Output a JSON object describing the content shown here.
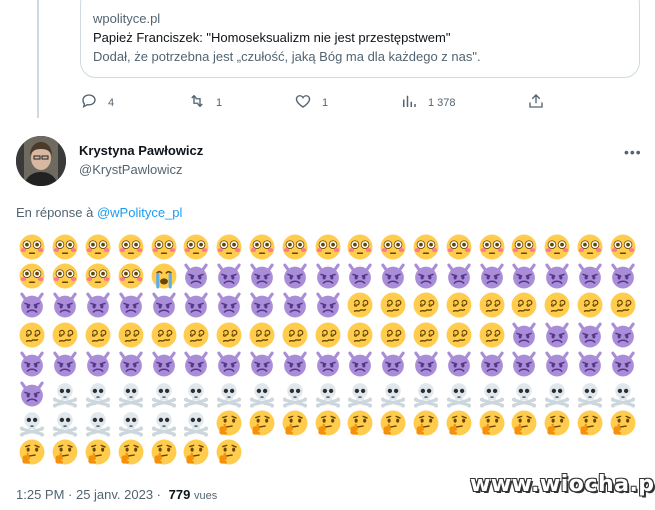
{
  "quoted_tweet": {
    "domain": "wpolityce.pl",
    "title": "Papież Franciszek: \"Homoseksualizm nie jest przestępstwem\"",
    "description": "Dodał, że potrzebna jest „czułość, jaką Bóg ma dla każdego z nas\"."
  },
  "actions": {
    "replies": "4",
    "retweets": "1",
    "likes": "1",
    "views": "1 378"
  },
  "tweet": {
    "author_name": "Krystyna Pawłowicz",
    "author_handle": "@KrystPawlowicz",
    "more_label": "•••",
    "reply_prefix": "En réponse à",
    "reply_mention": "@wPolityce_pl",
    "emoji_rows": [
      [
        "flushed",
        "flushed",
        "flushed",
        "flushed",
        "flushed",
        "flushed",
        "flushed",
        "flushed",
        "flushed",
        "flushed",
        "flushed",
        "flushed",
        "flushed",
        "flushed",
        "flushed",
        "flushed",
        "flushed",
        "flushed",
        "flushed"
      ],
      [
        "flushed",
        "flushed",
        "flushed",
        "flushed",
        "sob",
        "devil",
        "devil",
        "devil",
        "devil",
        "devil",
        "devil",
        "devil",
        "devil",
        "devil",
        "devil",
        "devil",
        "devil",
        "devil",
        "devil"
      ],
      [
        "devil",
        "devil",
        "devil",
        "devil",
        "devil",
        "devil",
        "devil",
        "devil",
        "devil",
        "devil",
        "dizzy",
        "dizzy",
        "dizzy",
        "dizzy",
        "dizzy",
        "dizzy",
        "dizzy",
        "dizzy",
        "dizzy"
      ],
      [
        "dizzy",
        "dizzy",
        "dizzy",
        "dizzy",
        "dizzy",
        "dizzy",
        "dizzy",
        "dizzy",
        "dizzy",
        "dizzy",
        "dizzy",
        "dizzy",
        "dizzy",
        "dizzy",
        "dizzy",
        "devil",
        "devil",
        "devil",
        "devil"
      ],
      [
        "devil",
        "devil",
        "devil",
        "devil",
        "devil",
        "devil",
        "devil",
        "devil",
        "devil",
        "devil",
        "devil",
        "devil",
        "devil",
        "devil",
        "devil",
        "devil",
        "devil",
        "devil",
        "devil"
      ],
      [
        "devil",
        "skull",
        "skull",
        "skull",
        "skull",
        "skull",
        "skull",
        "skull",
        "skull",
        "skull",
        "skull",
        "skull",
        "skull",
        "skull",
        "skull",
        "skull",
        "skull",
        "skull",
        "skull"
      ],
      [
        "skull",
        "skull",
        "skull",
        "skull",
        "skull",
        "skull",
        "thinking",
        "thinking",
        "thinking",
        "thinking",
        "thinking",
        "thinking",
        "thinking",
        "thinking",
        "thinking",
        "thinking",
        "thinking",
        "thinking",
        "thinking"
      ],
      [
        "thinking",
        "thinking",
        "thinking",
        "thinking",
        "thinking",
        "thinking",
        "thinking"
      ]
    ],
    "time": "1:25 PM · 25 janv. 2023 ·",
    "views_count": "779",
    "views_label": "vues"
  },
  "watermark": "www.wiocha.pl",
  "colors": {
    "accent": "#1d9bf0",
    "muted": "#536471",
    "border": "#cfd9de"
  }
}
